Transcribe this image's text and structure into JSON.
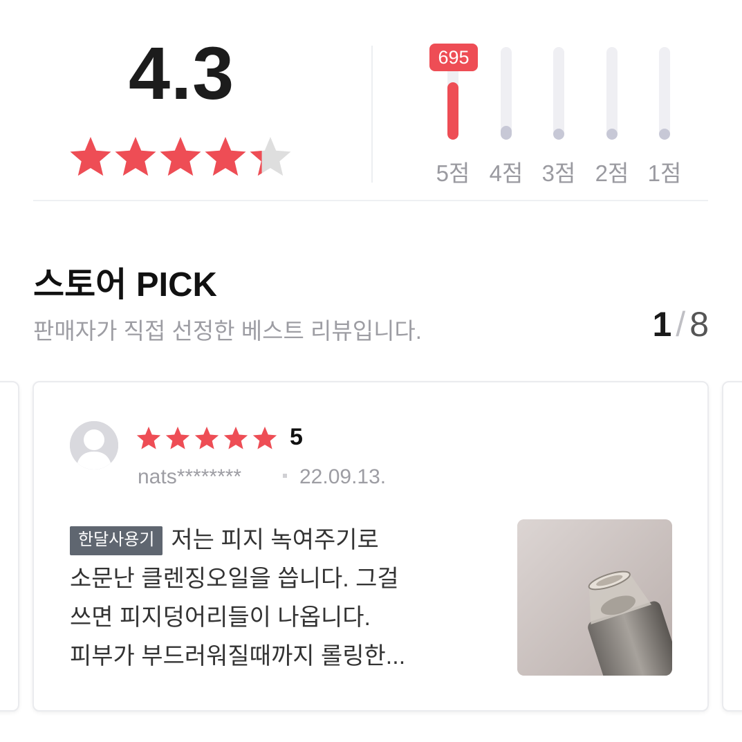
{
  "summary": {
    "average": "4.3",
    "average_value": 4.3,
    "max_stars": 5,
    "distribution": [
      {
        "label": "5점",
        "fraction": 0.62,
        "badge": "695",
        "highlight": true
      },
      {
        "label": "4점",
        "fraction": 0.15
      },
      {
        "label": "3점",
        "fraction": 0.05
      },
      {
        "label": "2점",
        "fraction": 0.05
      },
      {
        "label": "1점",
        "fraction": 0.05
      }
    ]
  },
  "pick": {
    "title": "스토어 PICK",
    "subtitle": "판매자가 직접 선정한 베스트 리뷰입니다.",
    "pager": {
      "current": "1",
      "separator": "/",
      "total": "8"
    }
  },
  "review": {
    "rating": "5",
    "rating_value": 5,
    "author": "nats********",
    "date": "22.09.13.",
    "tag": "한달사용기",
    "lines": [
      "저는 피지 녹여주기로",
      "소문난 클렌징오일을 씁니다. 그걸",
      "쓰면 피지덩어리들이 나옵니다.",
      "피부가 부드러워질때까지 롤링한..."
    ]
  },
  "colors": {
    "star_red": "#ee4d55",
    "star_empty": "#dedede",
    "bar_highlight": "#ee4d55",
    "bar_fill": "#c7c8d6",
    "bar_track": "#efeff3",
    "tag_bg": "#5f6670"
  },
  "icons": {
    "avatar": "default-user-avatar-icon",
    "star": "star-icon"
  }
}
